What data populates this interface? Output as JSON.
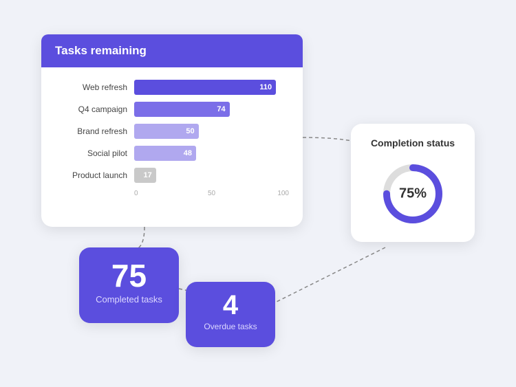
{
  "tasksCard": {
    "title": "Tasks remaining",
    "bars": [
      {
        "label": "Web refresh",
        "value": 110,
        "maxValue": 120,
        "colorClass": "dark"
      },
      {
        "label": "Q4 campaign",
        "value": 74,
        "maxValue": 120,
        "colorClass": "mid"
      },
      {
        "label": "Brand refresh",
        "value": 50,
        "maxValue": 120,
        "colorClass": "light"
      },
      {
        "label": "Social pilot",
        "value": 48,
        "maxValue": 120,
        "colorClass": "light"
      },
      {
        "label": "Product launch",
        "value": 17,
        "maxValue": 120,
        "colorClass": "gray"
      }
    ],
    "axisTicks": [
      "0",
      "50",
      "100"
    ]
  },
  "completionCard": {
    "title": "Completion status",
    "percent": 75,
    "label": "75%",
    "colors": {
      "filled": "#5b4ede",
      "track": "#ddd"
    }
  },
  "completedCard": {
    "number": "75",
    "label": "Completed tasks"
  },
  "overdueCard": {
    "number": "4",
    "label": "Overdue tasks"
  }
}
